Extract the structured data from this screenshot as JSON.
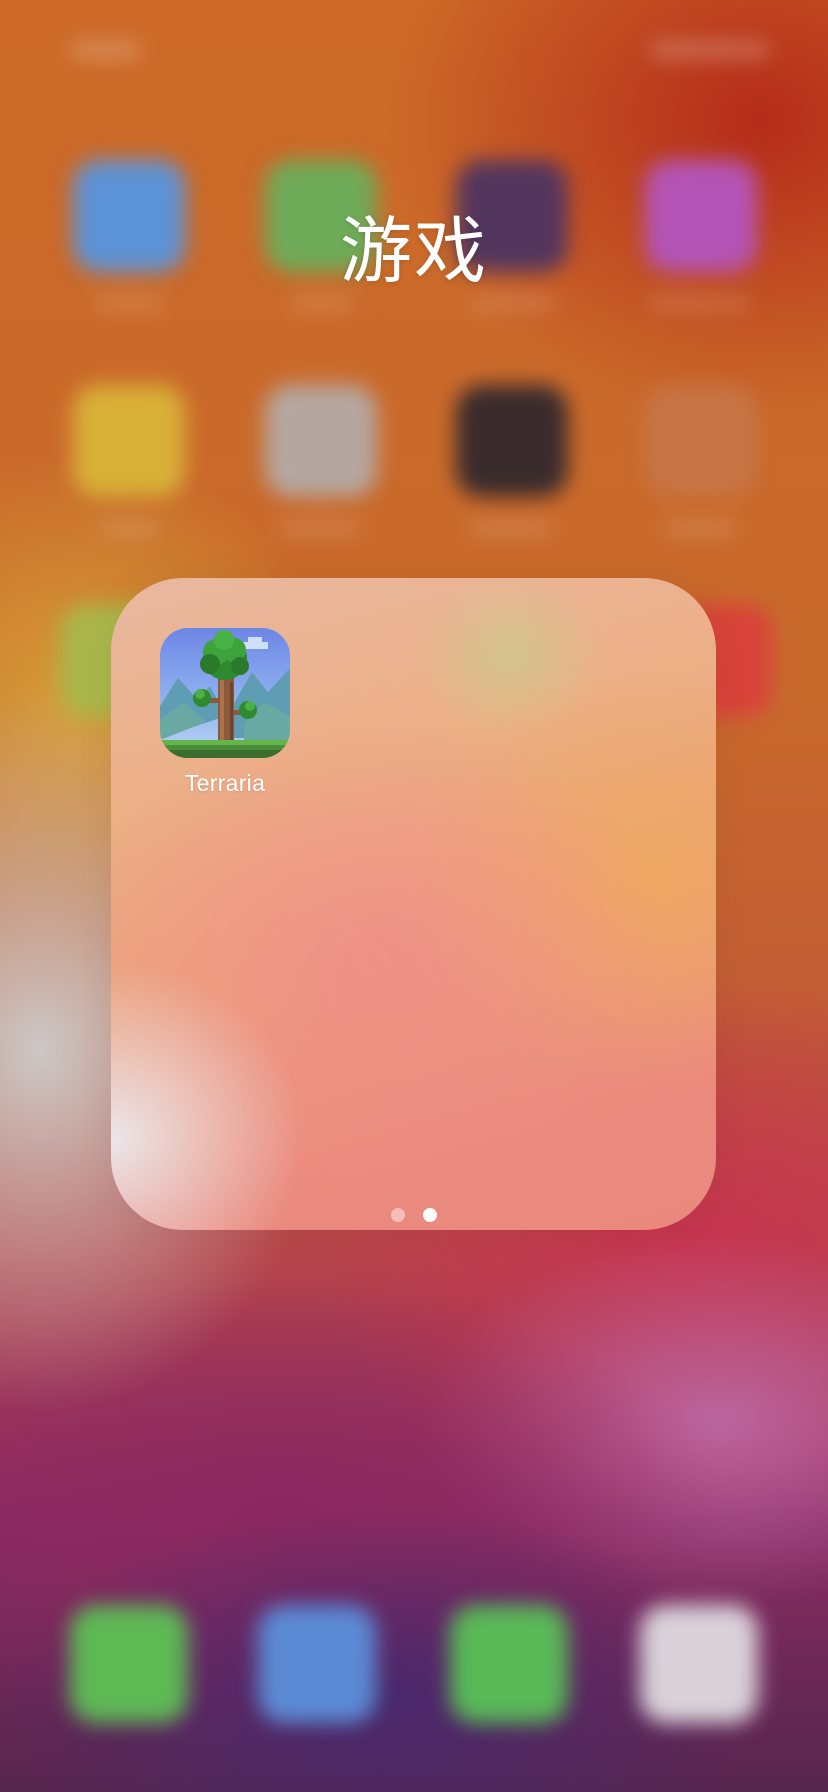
{
  "folder": {
    "title": "游戏",
    "apps": [
      {
        "label": "Terraria",
        "icon": "terraria-tree-icon"
      }
    ],
    "page_count": 2,
    "current_page": 2
  },
  "colors": {
    "folder_title": "#ffffff",
    "dot_active": "#ffffff",
    "dot_inactive": "rgba(255,255,255,0.45)"
  }
}
